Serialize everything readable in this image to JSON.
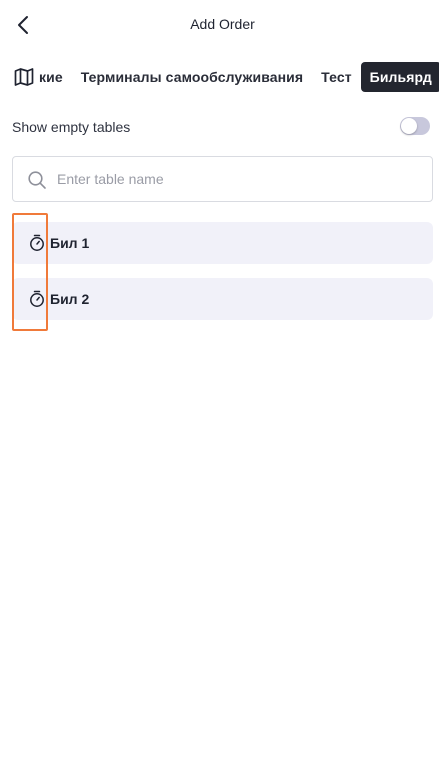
{
  "header": {
    "title": "Add Order",
    "back_icon": "chevron-left-icon"
  },
  "tabs": {
    "map_icon": "map-icon",
    "items": [
      {
        "label": "кие",
        "active": false
      },
      {
        "label": "Терминалы самообслуживания",
        "active": false
      },
      {
        "label": "Тест",
        "active": false
      },
      {
        "label": "Бильярд",
        "active": true
      }
    ]
  },
  "filters": {
    "show_empty_label": "Show empty tables",
    "show_empty_on": false
  },
  "search": {
    "placeholder": "Enter table name",
    "value": ""
  },
  "tables": [
    {
      "name": "Бил 1",
      "icon": "stopwatch-icon"
    },
    {
      "name": "Бил 2",
      "icon": "stopwatch-icon"
    }
  ],
  "colors": {
    "active_tab_bg": "#23262f",
    "item_bg": "#f1f1f9",
    "highlight": "#f07a3a",
    "toggle_off": "#c8c8dc"
  }
}
